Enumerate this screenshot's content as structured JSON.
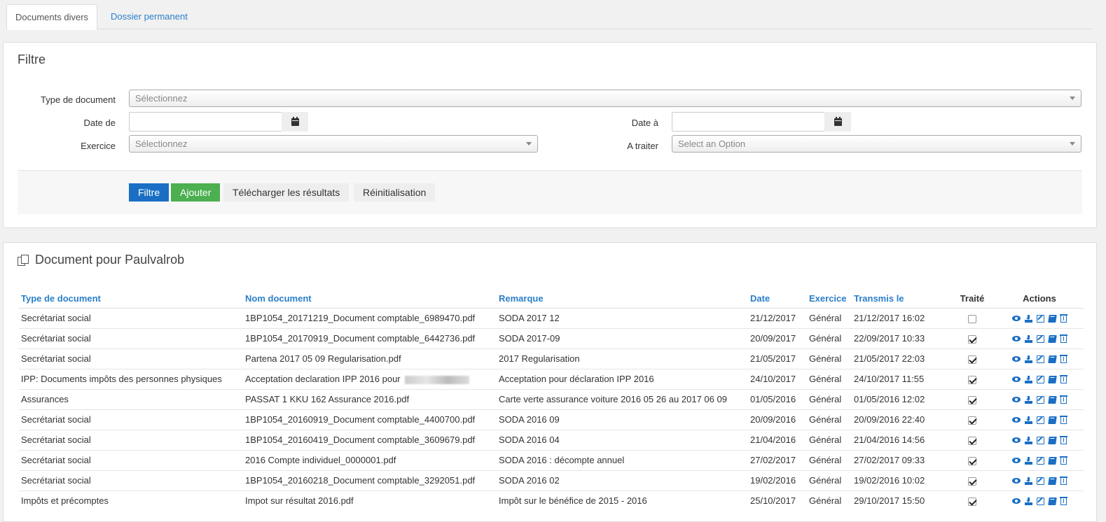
{
  "tabs": [
    {
      "label": "Documents divers",
      "active": true
    },
    {
      "label": "Dossier permanent",
      "active": false
    }
  ],
  "filter": {
    "title": "Filtre",
    "type_label": "Type de document",
    "type_placeholder": "Sélectionnez",
    "date_from_label": "Date de",
    "date_to_label": "Date à",
    "exercice_label": "Exercice",
    "exercice_placeholder": "Sélectionnez",
    "a_traiter_label": "A traiter",
    "a_traiter_placeholder": "Select an Option",
    "buttons": {
      "filter": "Filtre",
      "add": "Ajouter",
      "download": "Télécharger les résultats",
      "reset": "Réinitialisation"
    }
  },
  "documents": {
    "title": "Document pour Paulvalrob",
    "columns": [
      "Type de document",
      "Nom document",
      "Remarque",
      "Date",
      "Exercice",
      "Transmis le",
      "Traité",
      "Actions"
    ],
    "rows": [
      {
        "type": "Secrétariat social",
        "name": "1BP1054_20171219_Document comptable_6989470.pdf",
        "remark": "SODA 2017 12",
        "date": "21/12/2017",
        "exercice": "Général",
        "sent": "21/12/2017 16:02",
        "done": false
      },
      {
        "type": "Secrétariat social",
        "name": "1BP1054_20170919_Document comptable_6442736.pdf",
        "remark": "SODA 2017-09",
        "date": "20/09/2017",
        "exercice": "Général",
        "sent": "22/09/2017 10:33",
        "done": true
      },
      {
        "type": "Secrétariat social",
        "name": "Partena 2017 05 09 Regularisation.pdf",
        "remark": "2017 Regularisation",
        "date": "21/05/2017",
        "exercice": "Général",
        "sent": "21/05/2017 22:03",
        "done": true
      },
      {
        "type": "IPP: Documents impôts des personnes physiques",
        "name": "Acceptation declaration IPP 2016 pour",
        "remark": "Acceptation pour déclaration IPP 2016",
        "date": "24/10/2017",
        "exercice": "Général",
        "sent": "24/10/2017 11:55",
        "done": true
      },
      {
        "type": "Assurances",
        "name": "PASSAT 1 KKU 162 Assurance 2016.pdf",
        "remark": "Carte verte assurance voiture 2016 05 26 au 2017 06 09",
        "date": "01/05/2016",
        "exercice": "Général",
        "sent": "01/05/2016 12:02",
        "done": true
      },
      {
        "type": "Secrétariat social",
        "name": "1BP1054_20160919_Document comptable_4400700.pdf",
        "remark": "SODA 2016 09",
        "date": "20/09/2016",
        "exercice": "Général",
        "sent": "20/09/2016 22:40",
        "done": true
      },
      {
        "type": "Secrétariat social",
        "name": "1BP1054_20160419_Document comptable_3609679.pdf",
        "remark": "SODA 2016 04",
        "date": "21/04/2016",
        "exercice": "Général",
        "sent": "21/04/2016 14:56",
        "done": true
      },
      {
        "type": "Secrétariat social",
        "name": "2016 Compte individuel_0000001.pdf",
        "remark": "SODA 2016 : décompte annuel",
        "date": "27/02/2017",
        "exercice": "Général",
        "sent": "27/02/2017 09:33",
        "done": true
      },
      {
        "type": "Secrétariat social",
        "name": "1BP1054_20160218_Document comptable_3292051.pdf",
        "remark": "SODA 2016 02",
        "date": "19/02/2016",
        "exercice": "Général",
        "sent": "19/02/2016 10:02",
        "done": true
      },
      {
        "type": "Impôts et précomptes",
        "name": "Impot sur résultat 2016.pdf",
        "remark": "Impôt sur le bénéfice de 2015 - 2016",
        "date": "25/10/2017",
        "exercice": "Général",
        "sent": "29/10/2017 15:50",
        "done": true
      }
    ]
  },
  "icons": [
    "calendar-icon",
    "copy-icon",
    "eye-icon",
    "download-icon",
    "edit-icon",
    "book-icon",
    "trash-icon"
  ],
  "colors": {
    "link": "#2a7fc9",
    "primary": "#1a6fc4",
    "success": "#4caf50"
  }
}
